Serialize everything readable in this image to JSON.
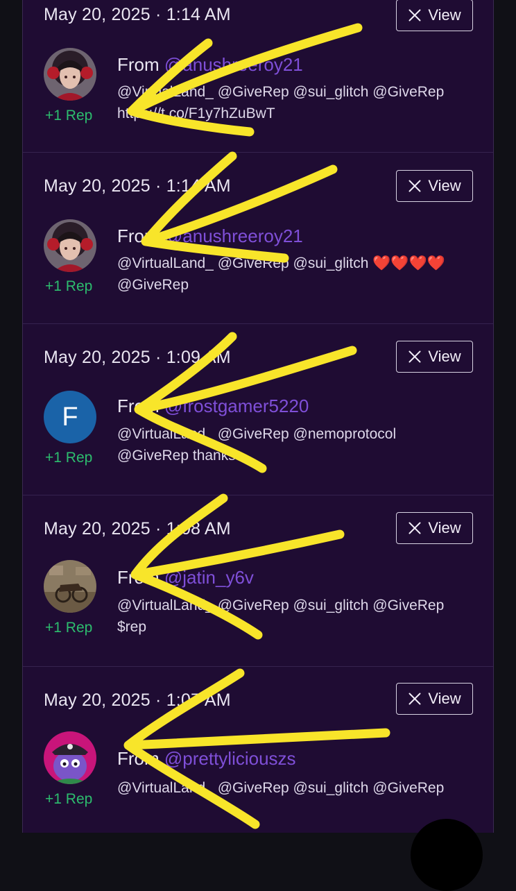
{
  "feed": {
    "view_label": "View",
    "rep_label": "+1 Rep",
    "from_prefix": "From ",
    "items": [
      {
        "date": "May 20, 2025 · 1:14 AM",
        "username": "@anushreeroy21",
        "message_lines": [
          "@VirtualLand_ @GiveRep @sui_glitch @GiveRep",
          "https://t.co/F1y7hZuBwT"
        ],
        "avatar": "anime-girl-avatar"
      },
      {
        "date": "May 20, 2025 · 1:14 AM",
        "username": "@anushreeroy21",
        "message_lines": [
          "@VirtualLand_ @GiveRep @sui_glitch ❤️❤️❤️❤️",
          "@GiveRep"
        ],
        "avatar": "anime-girl-avatar"
      },
      {
        "date": "May 20, 2025 · 1:09 AM",
        "username": "@frostgamer5220",
        "message_lines": [
          "@VirtualLand_ @GiveRep @nemoprotocol",
          "@GiveRep thanks"
        ],
        "avatar": "letter-avatar",
        "avatar_letter": "F",
        "avatar_color": "#1a63a8"
      },
      {
        "date": "May 20, 2025 · 1:08 AM",
        "username": "@jatin_y6v",
        "message_lines": [
          "@VirtualLand_ @GiveRep @sui_glitch @GiveRep",
          "$rep"
        ],
        "avatar": "photo-avatar"
      },
      {
        "date": "May 20, 2025 · 1:07 AM",
        "username": "@prettyliciouszs",
        "message_lines": [
          "@VirtualLand_ @GiveRep @sui_glitch @GiveRep"
        ],
        "avatar": "pirate-character-avatar"
      }
    ]
  },
  "colors": {
    "background": "#101016",
    "panel": "#1f0c33",
    "username": "#7f4fd8",
    "rep": "#2dbd6e",
    "annotation": "#f8e52a"
  },
  "annotation": {
    "type": "yellow-arrow-scribbles",
    "count": 5
  }
}
